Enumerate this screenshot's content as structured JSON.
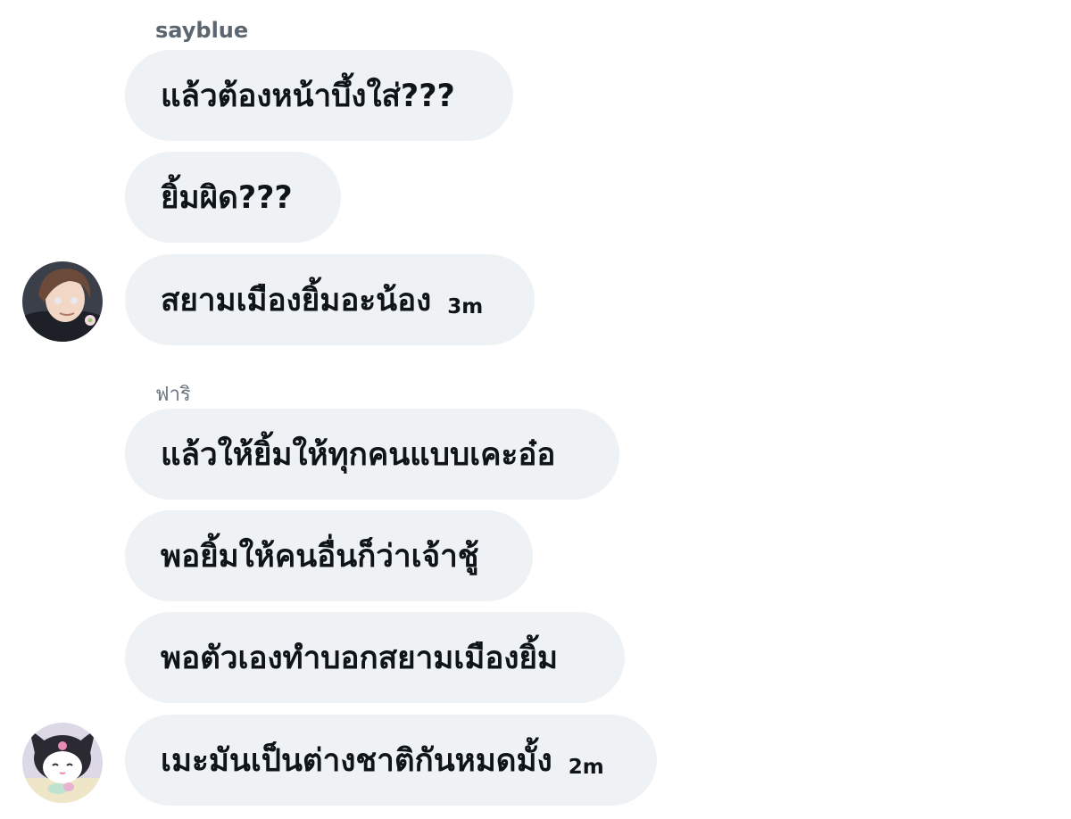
{
  "groups": [
    {
      "sender": "sayblue",
      "messages": [
        {
          "text": "แล้วต้องหน้าบึ้งใส่???",
          "time": ""
        },
        {
          "text": "ยิ้มผิด???",
          "time": ""
        },
        {
          "text": "สยามเมืองยิ้มอะน้อง",
          "time": "3m"
        }
      ]
    },
    {
      "sender": "ฟาริ",
      "messages": [
        {
          "text": "แล้วให้ยิ้มให้ทุกคนแบบเคะอ๋อ",
          "time": ""
        },
        {
          "text": "พอยิ้มให้คนอื่นก็ว่าเจ้าชู้",
          "time": ""
        },
        {
          "text": "พอตัวเองทำบอกสยามเมืองยิ้ม",
          "time": ""
        },
        {
          "text": "เมะมันเป็นต่างชาติกันหมดมั้ง",
          "time": "2m"
        }
      ]
    }
  ],
  "colors": {
    "bubble": "#eff2f4",
    "text": "#0f1419",
    "sender": "#5b6670"
  }
}
